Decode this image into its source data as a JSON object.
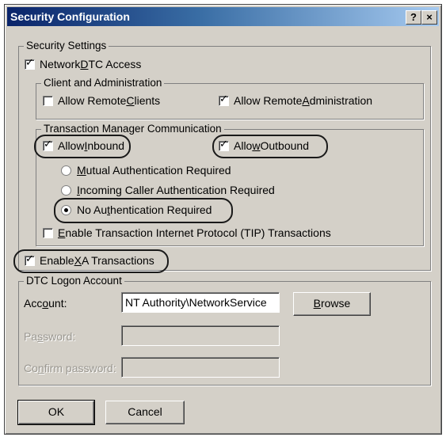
{
  "window": {
    "title": "Security Configuration",
    "help_button": "?",
    "close_button": "×"
  },
  "security_settings": {
    "legend": "Security Settings",
    "network_dtc_access": {
      "pre": "Network ",
      "key": "D",
      "post": "TC Access",
      "checked": true
    },
    "client_admin": {
      "legend": "Client and Administration",
      "allow_remote_clients": {
        "pre": "Allow Remote ",
        "key": "C",
        "post": "lients",
        "checked": false
      },
      "allow_remote_admin": {
        "pre": "Allow Remote ",
        "key": "A",
        "post": "dministration",
        "checked": true
      }
    },
    "tm_comm": {
      "legend": "Transaction Manager Communication",
      "allow_inbound": {
        "pre": "Allow ",
        "key": "I",
        "post": "nbound",
        "checked": true
      },
      "allow_outbound": {
        "pre": "Allo",
        "key": "w",
        "post": " Outbound",
        "checked": true
      },
      "mutual_auth": {
        "pre": "",
        "key": "M",
        "post": "utual Authentication Required",
        "selected": false
      },
      "incoming_caller_auth": {
        "pre": "",
        "key": "I",
        "post": "ncoming Caller Authentication Required",
        "selected": false
      },
      "no_auth": {
        "pre": "No Au",
        "key": "t",
        "post": "hentication Required",
        "selected": true
      }
    },
    "tip": {
      "pre": "",
      "key": "E",
      "post": "nable Transaction Internet Protocol (TIP) Transactions",
      "checked": false
    },
    "xa": {
      "pre": "Enable ",
      "key": "X",
      "post": "A Transactions",
      "checked": true
    }
  },
  "logon": {
    "legend": "DTC Logon Account",
    "account_label": {
      "pre": "Acc",
      "key": "o",
      "post": "unt:"
    },
    "account_value": "NT Authority\\NetworkService",
    "browse_button": {
      "pre": "",
      "key": "B",
      "post": "rowse"
    },
    "password_label": {
      "pre": "Pa",
      "key": "s",
      "post": "sword:"
    },
    "password_value": "",
    "confirm_label": {
      "pre": "Co",
      "key": "n",
      "post": "firm password:"
    },
    "confirm_value": ""
  },
  "buttons": {
    "ok": "OK",
    "cancel": "Cancel"
  }
}
